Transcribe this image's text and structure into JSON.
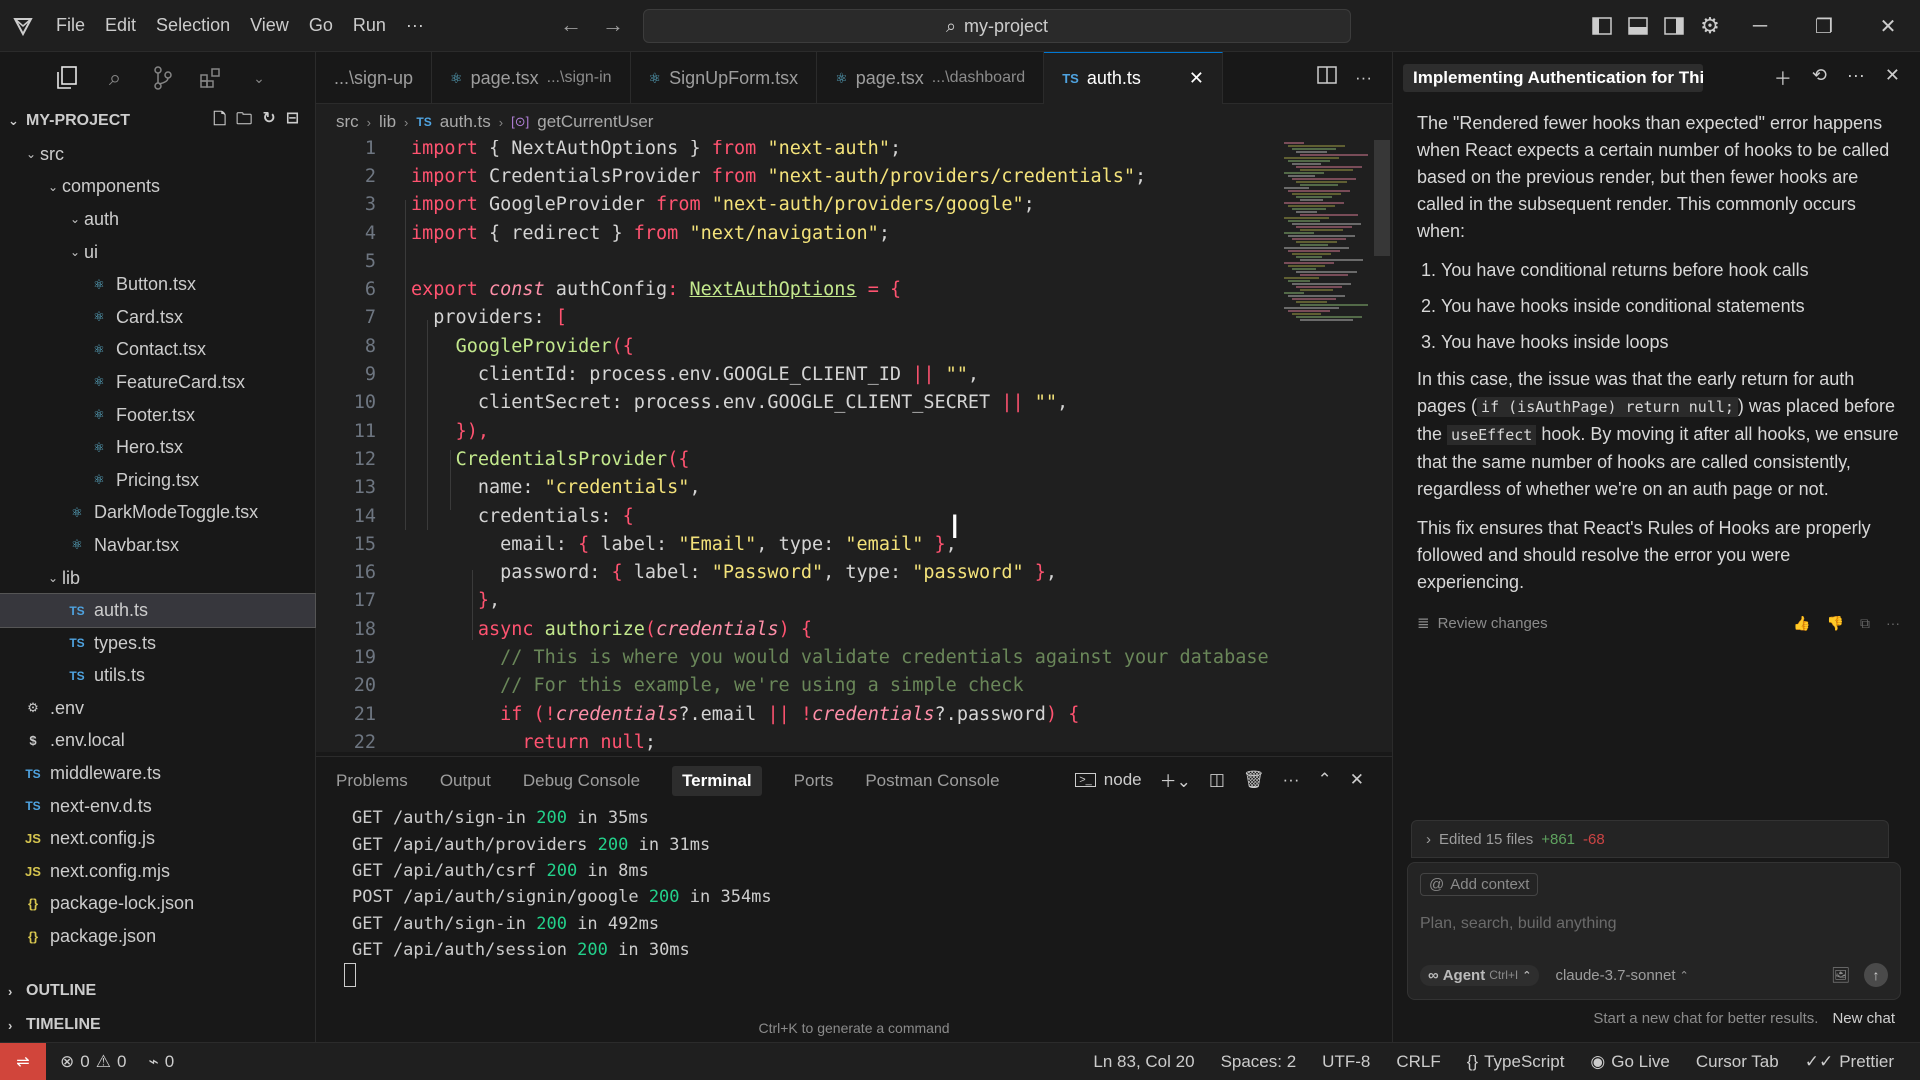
{
  "menu": [
    "File",
    "Edit",
    "Selection",
    "View",
    "Go",
    "Run",
    "···"
  ],
  "search": {
    "text": "my-project"
  },
  "explorer": {
    "title": "MY-PROJECT",
    "tree": [
      {
        "label": "src",
        "type": "folder",
        "depth": 1,
        "open": true
      },
      {
        "label": "components",
        "type": "folder",
        "depth": 2,
        "open": true
      },
      {
        "label": "auth",
        "type": "folder",
        "depth": 3,
        "open": true
      },
      {
        "label": "ui",
        "type": "folder",
        "depth": 3,
        "open": true
      },
      {
        "label": "Button.tsx",
        "type": "react",
        "depth": 4
      },
      {
        "label": "Card.tsx",
        "type": "react",
        "depth": 4
      },
      {
        "label": "Contact.tsx",
        "type": "react",
        "depth": 4
      },
      {
        "label": "FeatureCard.tsx",
        "type": "react",
        "depth": 4
      },
      {
        "label": "Footer.tsx",
        "type": "react",
        "depth": 4
      },
      {
        "label": "Hero.tsx",
        "type": "react",
        "depth": 4
      },
      {
        "label": "Pricing.tsx",
        "type": "react",
        "depth": 4
      },
      {
        "label": "DarkModeToggle.tsx",
        "type": "react",
        "depth": 3
      },
      {
        "label": "Navbar.tsx",
        "type": "react",
        "depth": 3
      },
      {
        "label": "lib",
        "type": "folder",
        "depth": 2,
        "open": true
      },
      {
        "label": "auth.ts",
        "type": "ts",
        "depth": 3,
        "selected": true
      },
      {
        "label": "types.ts",
        "type": "ts",
        "depth": 3
      },
      {
        "label": "utils.ts",
        "type": "ts",
        "depth": 3
      },
      {
        "label": ".env",
        "type": "env",
        "depth": 1
      },
      {
        "label": ".env.local",
        "type": "dollar",
        "depth": 1
      },
      {
        "label": "middleware.ts",
        "type": "ts",
        "depth": 1
      },
      {
        "label": "next-env.d.ts",
        "type": "ts",
        "depth": 1
      },
      {
        "label": "next.config.js",
        "type": "js",
        "depth": 1
      },
      {
        "label": "next.config.mjs",
        "type": "js",
        "depth": 1
      },
      {
        "label": "package-lock.json",
        "type": "json",
        "depth": 1
      },
      {
        "label": "package.json",
        "type": "json",
        "depth": 1
      }
    ],
    "outline_label": "OUTLINE",
    "timeline_label": "TIMELINE"
  },
  "tabs": [
    {
      "label": "...\\sign-up",
      "icon": "none"
    },
    {
      "label": "page.tsx",
      "desc": "...\\sign-in",
      "icon": "react"
    },
    {
      "label": "SignUpForm.tsx",
      "icon": "react"
    },
    {
      "label": "page.tsx",
      "desc": "...\\dashboard",
      "icon": "react"
    },
    {
      "label": "auth.ts",
      "icon": "ts",
      "active": true
    }
  ],
  "breadcrumb": [
    "src",
    "lib",
    "auth.ts",
    "getCurrentUser"
  ],
  "code": {
    "lines": [
      [
        [
          "k",
          "import"
        ],
        [
          "w",
          " { NextAuthOptions } "
        ],
        [
          "k",
          "from"
        ],
        [
          "w",
          " "
        ],
        [
          "s",
          "\"next-auth\""
        ],
        [
          "w",
          ";"
        ]
      ],
      [
        [
          "k",
          "import"
        ],
        [
          "w",
          " CredentialsProvider "
        ],
        [
          "k",
          "from"
        ],
        [
          "w",
          " "
        ],
        [
          "s",
          "\"next-auth/providers/credentials\""
        ],
        [
          "w",
          ";"
        ]
      ],
      [
        [
          "k",
          "import"
        ],
        [
          "w",
          " GoogleProvider "
        ],
        [
          "k",
          "from"
        ],
        [
          "w",
          " "
        ],
        [
          "s",
          "\"next-auth/providers/google\""
        ],
        [
          "w",
          ";"
        ]
      ],
      [
        [
          "k",
          "import"
        ],
        [
          "w",
          " { redirect } "
        ],
        [
          "k",
          "from"
        ],
        [
          "w",
          " "
        ],
        [
          "s",
          "\"next/navigation\""
        ],
        [
          "w",
          ";"
        ]
      ],
      [],
      [
        [
          "k",
          "export"
        ],
        [
          "w",
          " "
        ],
        [
          "it",
          "const"
        ],
        [
          "w",
          " authConfig"
        ],
        [
          "p",
          ":"
        ],
        [
          "w",
          " "
        ],
        [
          "ty",
          "NextAuthOptions"
        ],
        [
          "w",
          " "
        ],
        [
          "p",
          "="
        ],
        [
          "w",
          " "
        ],
        [
          "p",
          "{"
        ]
      ],
      [
        [
          "w",
          "  providers: "
        ],
        [
          "p",
          "["
        ]
      ],
      [
        [
          "w",
          "    "
        ],
        [
          "fn",
          "GoogleProvider"
        ],
        [
          "p",
          "({"
        ]
      ],
      [
        [
          "w",
          "      clientId: process.env.GOOGLE_CLIENT_ID "
        ],
        [
          "p",
          "||"
        ],
        [
          "w",
          " "
        ],
        [
          "s",
          "\"\""
        ],
        [
          "w",
          ","
        ]
      ],
      [
        [
          "w",
          "      clientSecret: process.env.GOOGLE_CLIENT_SECRET "
        ],
        [
          "p",
          "||"
        ],
        [
          "w",
          " "
        ],
        [
          "s",
          "\"\""
        ],
        [
          "w",
          ","
        ]
      ],
      [
        [
          "w",
          "    "
        ],
        [
          "p",
          "}),"
        ]
      ],
      [
        [
          "w",
          "    "
        ],
        [
          "fn",
          "CredentialsProvider"
        ],
        [
          "p",
          "({"
        ]
      ],
      [
        [
          "w",
          "      name: "
        ],
        [
          "s",
          "\"credentials\""
        ],
        [
          "w",
          ","
        ]
      ],
      [
        [
          "w",
          "      credentials: "
        ],
        [
          "p",
          "{"
        ]
      ],
      [
        [
          "w",
          "        email: "
        ],
        [
          "p",
          "{"
        ],
        [
          "w",
          " label: "
        ],
        [
          "s",
          "\"Email\""
        ],
        [
          "w",
          ", type: "
        ],
        [
          "s",
          "\"email\""
        ],
        [
          "w",
          " "
        ],
        [
          "p",
          "}"
        ],
        [
          "w",
          ","
        ]
      ],
      [
        [
          "w",
          "        password: "
        ],
        [
          "p",
          "{"
        ],
        [
          "w",
          " label: "
        ],
        [
          "s",
          "\"Password\""
        ],
        [
          "w",
          ", type: "
        ],
        [
          "s",
          "\"password\""
        ],
        [
          "w",
          " "
        ],
        [
          "p",
          "}"
        ],
        [
          "w",
          ","
        ]
      ],
      [
        [
          "w",
          "      "
        ],
        [
          "p",
          "}"
        ],
        [
          "w",
          ","
        ]
      ],
      [
        [
          "w",
          "      "
        ],
        [
          "k",
          "async"
        ],
        [
          "w",
          " "
        ],
        [
          "fn",
          "authorize"
        ],
        [
          "p",
          "("
        ],
        [
          "it",
          "credentials"
        ],
        [
          "p",
          ")"
        ],
        [
          "w",
          " "
        ],
        [
          "p",
          "{"
        ]
      ],
      [
        [
          "c",
          "        // This is where you would validate credentials against your database"
        ]
      ],
      [
        [
          "c",
          "        // For this example, we're using a simple check"
        ]
      ],
      [
        [
          "w",
          "        "
        ],
        [
          "k",
          "if"
        ],
        [
          "w",
          " "
        ],
        [
          "p",
          "(!"
        ],
        [
          "it",
          "credentials"
        ],
        [
          "w",
          "?.email "
        ],
        [
          "p",
          "||"
        ],
        [
          "w",
          " "
        ],
        [
          "p",
          "!"
        ],
        [
          "it",
          "credentials"
        ],
        [
          "w",
          "?.password"
        ],
        [
          "p",
          ")"
        ],
        [
          "w",
          " "
        ],
        [
          "p",
          "{"
        ]
      ],
      [
        [
          "w",
          "          "
        ],
        [
          "k",
          "return"
        ],
        [
          "w",
          " "
        ],
        [
          "k",
          "null"
        ],
        [
          "w",
          ";"
        ]
      ]
    ]
  },
  "panel": {
    "tabs": [
      "Problems",
      "Output",
      "Debug Console",
      "Terminal",
      "Ports",
      "Postman Console"
    ],
    "active_tab": "Terminal",
    "shell": "node",
    "terminal": [
      {
        "pre": "GET /auth/sign-in ",
        "code": "200",
        "post": " in 35ms"
      },
      {
        "pre": "GET /api/auth/providers ",
        "code": "200",
        "post": " in 31ms"
      },
      {
        "pre": "GET /api/auth/csrf ",
        "code": "200",
        "post": " in 8ms"
      },
      {
        "pre": "POST /api/auth/signin/google ",
        "code": "200",
        "post": " in 354ms"
      },
      {
        "pre": "GET /auth/sign-in ",
        "code": "200",
        "post": " in 492ms"
      },
      {
        "pre": "GET /api/auth/session ",
        "code": "200",
        "post": " in 30ms"
      }
    ],
    "hint": "Ctrl+K to generate a command"
  },
  "chat": {
    "title": "Implementing Authentication for Thi",
    "para1": "The \"Rendered fewer hooks than expected\" error happens when React expects a certain number of hooks to be called based on the previous render, but then fewer hooks are called in the subsequent render. This commonly occurs when:",
    "list": [
      "You have conditional returns before hook calls",
      "You have hooks inside conditional statements",
      "You have hooks inside loops"
    ],
    "para2_a": "In this case, the issue was that the early return for auth pages (",
    "para2_code1": "if (isAuthPage) return null;",
    "para2_b": ") was placed before the ",
    "para2_code2": "useEffect",
    "para2_c": " hook. By moving it after all hooks, we ensure that the same number of hooks are called consistently, regardless of whether we're on an auth page or not.",
    "para3": "This fix ensures that React's Rules of Hooks are properly followed and should resolve the error you were experiencing.",
    "review": "Review changes",
    "edited": "Edited 15 files",
    "added": "+861",
    "removed": "-68",
    "add_context": "Add context",
    "placeholder": "Plan, search, build anything",
    "agent": "Agent",
    "agent_kbd": "Ctrl+I",
    "model": "claude-3.7-sonnet",
    "footer_hint": "Start a new chat for better results.",
    "new_chat": "New chat"
  },
  "status": {
    "errors": "0",
    "warnings": "0",
    "ports": "0",
    "position": "Ln 83, Col 20",
    "spaces": "Spaces: 2",
    "encoding": "UTF-8",
    "eol": "CRLF",
    "language": "TypeScript",
    "golive": "Go Live",
    "cursortab": "Cursor Tab",
    "prettier": "Prettier"
  }
}
